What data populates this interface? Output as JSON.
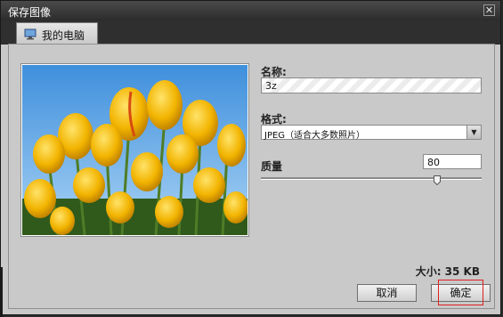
{
  "window": {
    "title": "保存图像"
  },
  "tab": {
    "label": "我的电脑",
    "icon": "computer-icon"
  },
  "form": {
    "name_label": "名称:",
    "name_value": "3z",
    "format_label": "格式:",
    "format_value": "JPEG（适合大多数照片）",
    "quality_label": "质量",
    "quality_value": "80",
    "quality_level": 0.8
  },
  "size_text": "大小: 35 KB",
  "buttons": {
    "cancel": "取消",
    "ok": "确定"
  },
  "colors": {
    "highlight": "#e02020",
    "sky": "#5aa9e8",
    "tulip": "#f2b400"
  }
}
